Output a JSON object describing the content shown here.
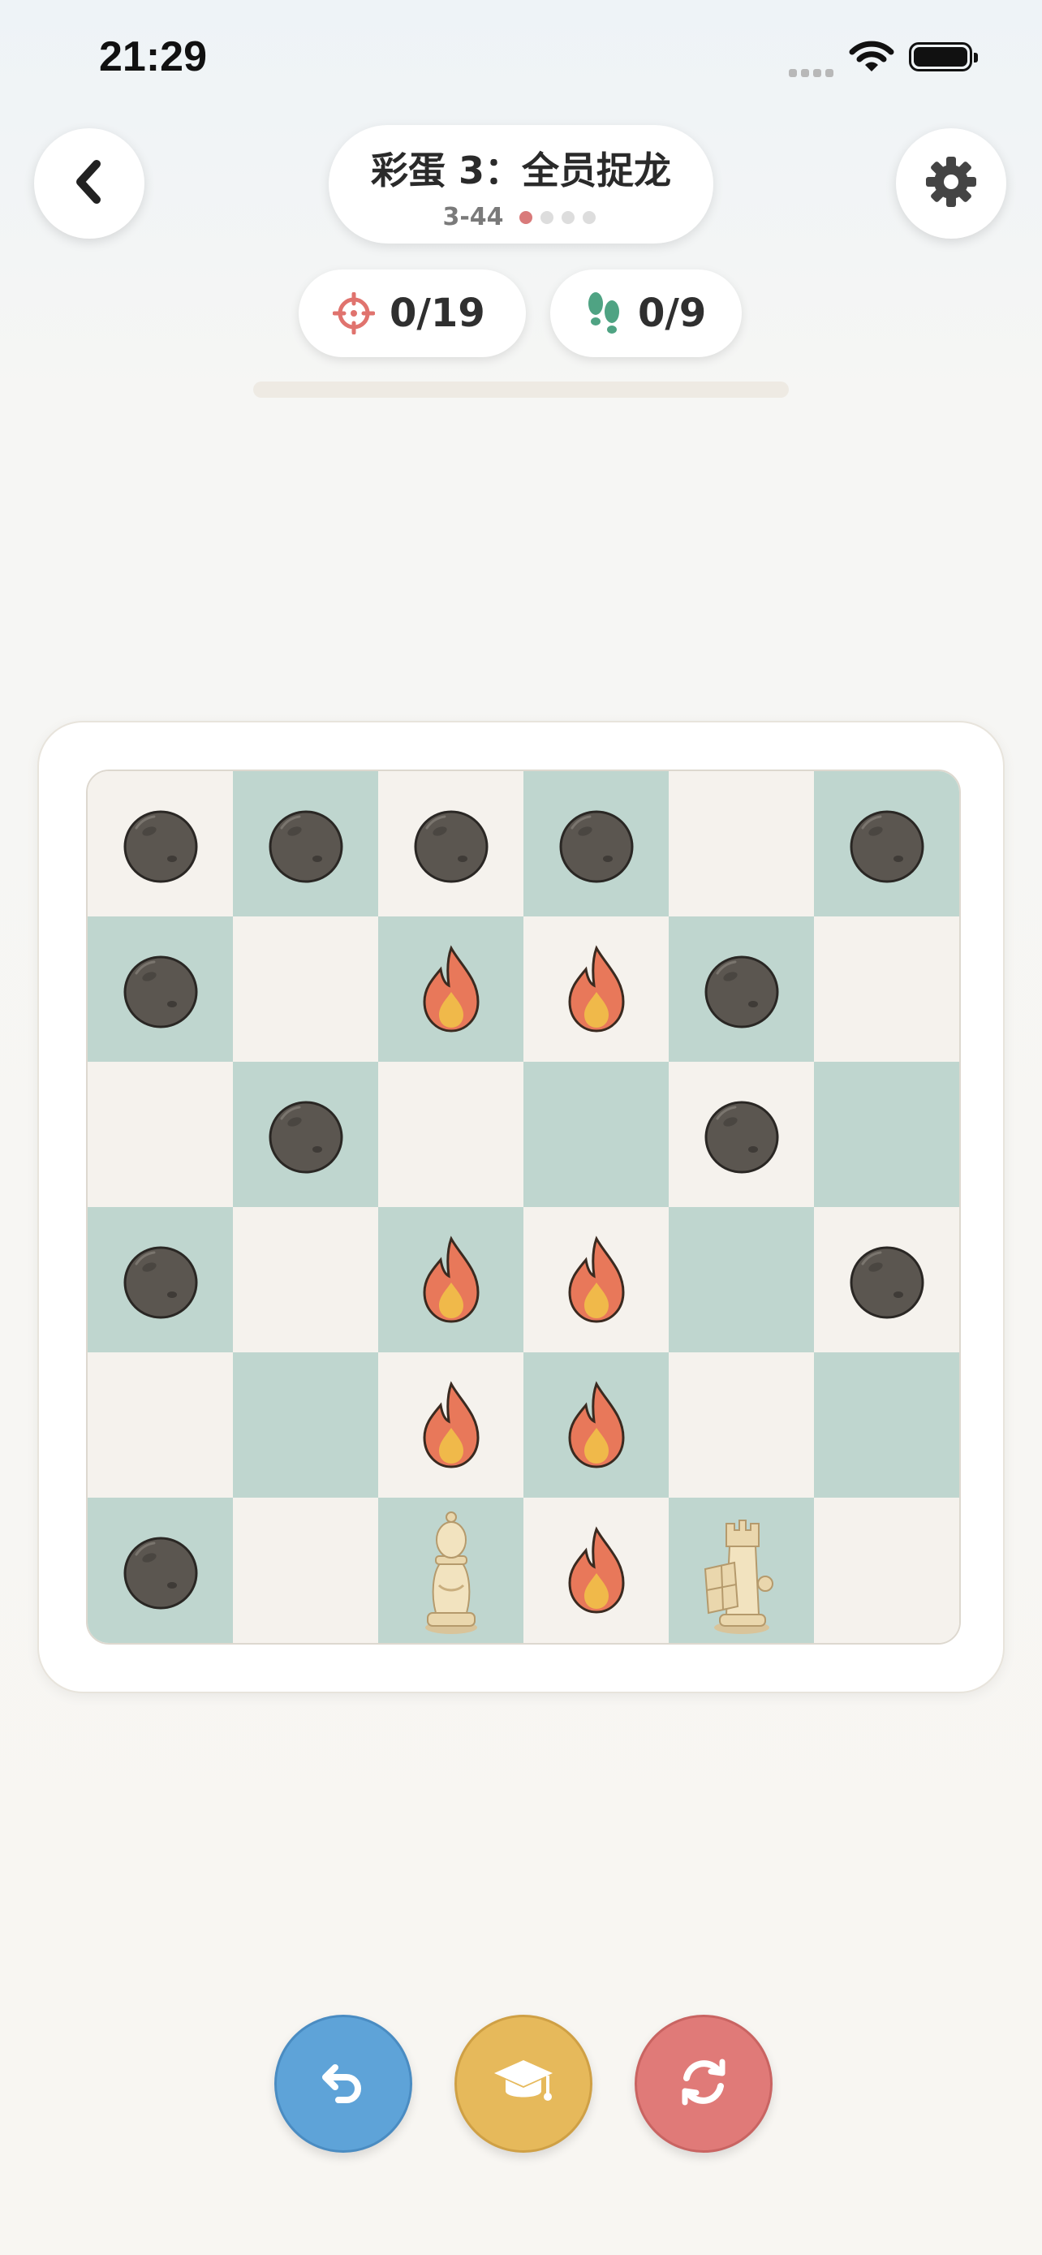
{
  "status_bar": {
    "time": "21:29"
  },
  "header": {
    "title": "彩蛋 3：全员捉龙",
    "level_id": "3-44",
    "page_dots": {
      "total": 4,
      "active": 0
    }
  },
  "counters": {
    "captures": "0/19",
    "moves": "0/9"
  },
  "progress": {
    "fraction": 0
  },
  "board": {
    "size": 6,
    "rows": [
      [
        "rock",
        "rock",
        "rock",
        "rock",
        "",
        "rock"
      ],
      [
        "rock",
        "",
        "fire",
        "fire",
        "rock",
        ""
      ],
      [
        "",
        "rock",
        "",
        "",
        "rock",
        ""
      ],
      [
        "rock",
        "",
        "fire",
        "fire",
        "",
        "rock"
      ],
      [
        "",
        "",
        "fire",
        "fire",
        "",
        ""
      ],
      [
        "rock",
        "",
        "bishop",
        "fire",
        "rook",
        ""
      ]
    ]
  },
  "actions": {
    "undo": "undo-icon",
    "hint": "graduation-cap-icon",
    "restart": "restart-icon"
  },
  "colors": {
    "light_square": "#f5f2ed",
    "dark_square": "#bfd6cf",
    "undo": "#5ea3d8",
    "hint": "#e6b95b",
    "restart": "#e07a78"
  }
}
